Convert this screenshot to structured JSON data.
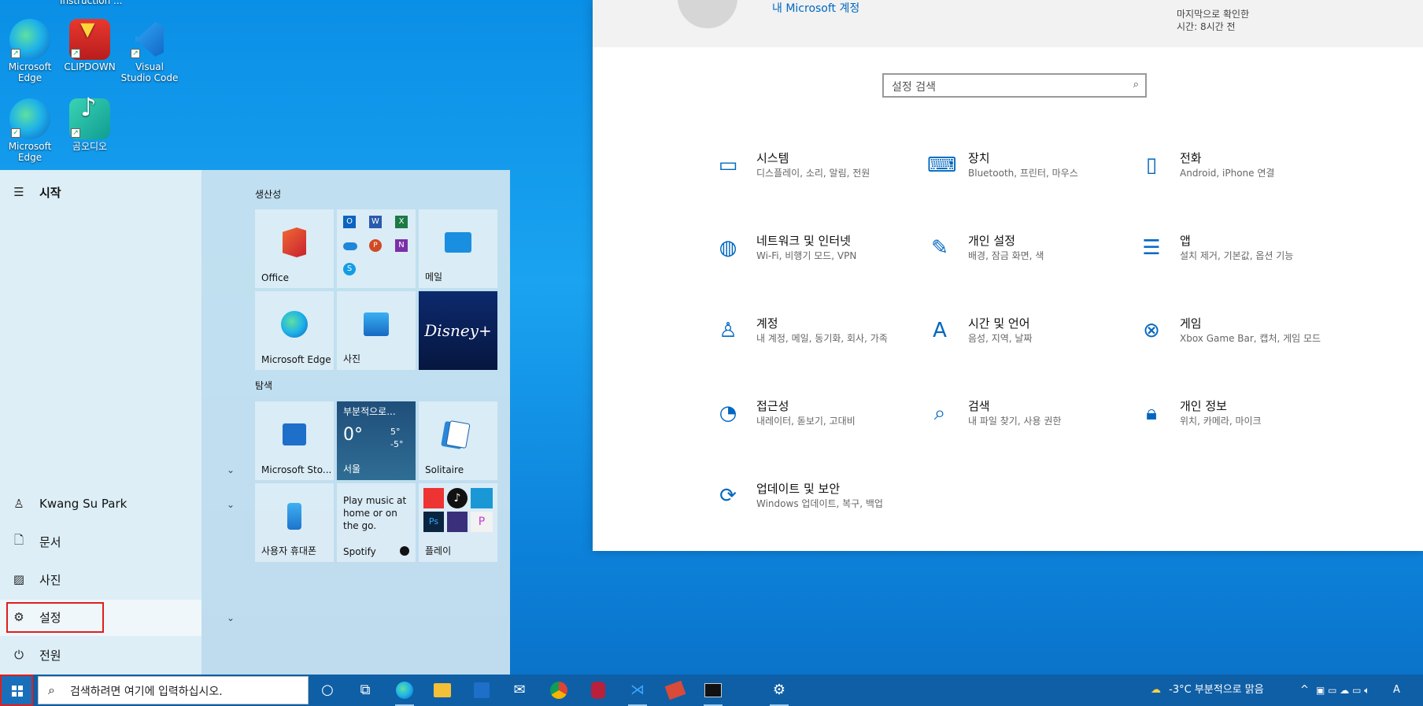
{
  "desktop": {
    "partial_top_label": "Instruction ...",
    "icons": [
      {
        "label": "Microsoft Edge"
      },
      {
        "label": "CLIPDOWN"
      },
      {
        "label": "Visual Studio Code"
      },
      {
        "label": "Microsoft Edge"
      },
      {
        "label": "곰오디오"
      }
    ]
  },
  "start_menu": {
    "title": "시작",
    "user": "Kwang Su Park",
    "items": [
      {
        "label": "문서",
        "icon": "document-icon"
      },
      {
        "label": "사진",
        "icon": "picture-icon"
      },
      {
        "label": "설정",
        "icon": "gear-icon"
      },
      {
        "label": "전원",
        "icon": "power-icon"
      }
    ],
    "groups": [
      {
        "label": "생산성"
      },
      {
        "label": "탐색"
      }
    ],
    "tiles": {
      "office": "Office",
      "mail": "메일",
      "edge": "Microsoft Edge",
      "photos": "사진",
      "disney": "Disney+",
      "store": "Microsoft Sto...",
      "weather_condition": "부분적으로...",
      "weather_temp": "0°",
      "weather_hi": "5°",
      "weather_lo": "-5°",
      "weather_city": "서울",
      "solitaire": "Solitaire",
      "phone": "사용자 휴대폰",
      "spotify_text": "Play music at home or on the go.",
      "spotify": "Spotify",
      "play": "플레이"
    }
  },
  "settings": {
    "top_link": "내 Microsoft 계정",
    "top_status1": "마지막으로 확인한",
    "top_status2": "시간: 8시간 전",
    "search_placeholder": "설정 검색",
    "categories": [
      {
        "title": "시스템",
        "desc": "디스플레이, 소리, 알림, 전원",
        "icon": "laptop-icon"
      },
      {
        "title": "장치",
        "desc": "Bluetooth, 프린터, 마우스",
        "icon": "keyboard-icon"
      },
      {
        "title": "전화",
        "desc": "Android, iPhone 연결",
        "icon": "phone-icon"
      },
      {
        "title": "네트워크 및 인터넷",
        "desc": "Wi-Fi, 비행기 모드, VPN",
        "icon": "globe-icon"
      },
      {
        "title": "개인 설정",
        "desc": "배경, 잠금 화면, 색",
        "icon": "paint-icon"
      },
      {
        "title": "앱",
        "desc": "설치 제거, 기본값, 옵션 기능",
        "icon": "apps-list-icon"
      },
      {
        "title": "계정",
        "desc": "내 계정, 메일, 동기화, 회사, 가족",
        "icon": "person-icon"
      },
      {
        "title": "시간 및 언어",
        "desc": "음성, 지역, 날짜",
        "icon": "language-icon"
      },
      {
        "title": "게임",
        "desc": "Xbox Game Bar, 캡처, 게임 모드",
        "icon": "xbox-icon"
      },
      {
        "title": "접근성",
        "desc": "내레이터, 돋보기, 고대비",
        "icon": "ease-of-access-icon"
      },
      {
        "title": "검색",
        "desc": "내 파일 찾기, 사용 권한",
        "icon": "search-icon"
      },
      {
        "title": "개인 정보",
        "desc": "위치, 카메라, 마이크",
        "icon": "lock-icon"
      },
      {
        "title": "업데이트 및 보안",
        "desc": "Windows 업데이트, 복구, 백업",
        "icon": "update-icon"
      }
    ]
  },
  "taskbar": {
    "search_placeholder": "검색하려면 여기에 입력하십시오.",
    "weather": "-3°C  부분적으로 맑음",
    "ime": "A"
  },
  "colors": {
    "accent": "#0067c0",
    "highlight_box": "#e01e1e",
    "taskbar": "#0f5fa6"
  }
}
